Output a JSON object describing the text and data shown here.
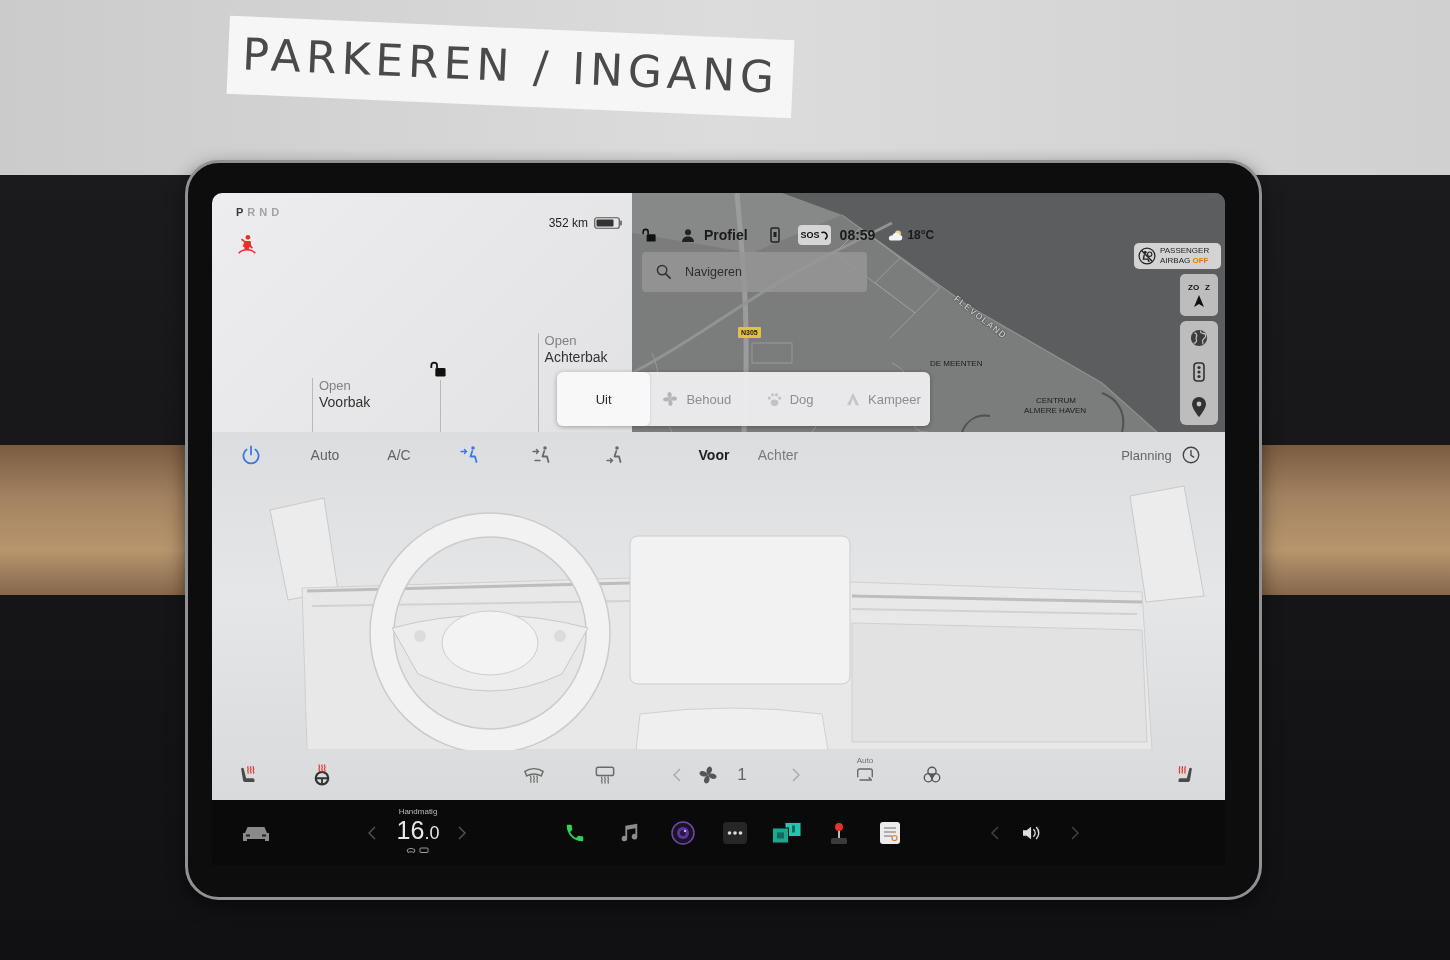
{
  "scene": {
    "sign": "PARKEREN / INGANG"
  },
  "car_panel": {
    "gears": [
      {
        "label": "P",
        "selected": true
      },
      {
        "label": "R",
        "selected": false
      },
      {
        "label": "N",
        "selected": false
      },
      {
        "label": "D",
        "selected": false
      }
    ],
    "seatbelt_warning": true,
    "range": "352 km",
    "locked": false,
    "frunk": {
      "action": "Open",
      "label": "Voorbak"
    },
    "trunk": {
      "action": "Open",
      "label": "Achterbak"
    }
  },
  "status_bar": {
    "locked": false,
    "profile": "Profiel",
    "sos": "SOS",
    "time": "08:59",
    "temperature": "18°C"
  },
  "map": {
    "search": {
      "placeholder": "Navigeren"
    },
    "airbag": {
      "label": "PASSENGER AIRBAG",
      "status": "OFF"
    },
    "heading": [
      "ZO",
      "Z"
    ],
    "labels": [
      {
        "kind": "road",
        "text": "N305"
      },
      {
        "kind": "region",
        "text": "FLEVOLAND"
      },
      {
        "kind": "place",
        "text": "DE MEENTEN"
      },
      {
        "kind": "place",
        "text": "CENTRUM"
      },
      {
        "kind": "place",
        "text": "ALMERE HAVEN"
      }
    ]
  },
  "mode_menu": {
    "options": [
      {
        "kind": "off",
        "label": "Uit",
        "selected": true
      },
      {
        "kind": "keep",
        "label": "Behoud",
        "selected": false
      },
      {
        "kind": "dog",
        "label": "Dog",
        "selected": false
      },
      {
        "kind": "camp",
        "label": "Kampeer",
        "selected": false
      }
    ]
  },
  "climate": {
    "power": true,
    "modes": [
      {
        "label": "Auto",
        "on": false
      },
      {
        "label": "A/C",
        "on": false
      }
    ],
    "airflow": [
      {
        "kind": "face",
        "selected": true
      },
      {
        "kind": "face-feet",
        "selected": false
      },
      {
        "kind": "feet",
        "selected": false
      }
    ],
    "zones": [
      {
        "label": "Voor",
        "selected": true
      },
      {
        "label": "Achter",
        "selected": false
      }
    ],
    "schedule": "Planning",
    "bottom_controls": [
      {
        "kind": "seat-heater",
        "on": true
      },
      {
        "kind": "wheel-heater",
        "on": true
      },
      {
        "kind": "front-defrost",
        "on": false
      },
      {
        "kind": "rear-defrost",
        "on": false
      },
      {
        "kind": "fan",
        "speed": "1"
      },
      {
        "kind": "recirculate",
        "label": "Auto"
      },
      {
        "kind": "biohazard",
        "on": false
      },
      {
        "kind": "seat-heater",
        "on": true
      }
    ]
  },
  "taskbar": {
    "climate_mode": "Handmatig",
    "temperature": {
      "whole": "16",
      "decimal": ".0"
    },
    "apps": [
      {
        "kind": "phone"
      },
      {
        "kind": "music"
      },
      {
        "kind": "camera"
      },
      {
        "kind": "more"
      },
      {
        "kind": "theater"
      },
      {
        "kind": "arcade"
      },
      {
        "kind": "notepad"
      }
    ]
  }
}
